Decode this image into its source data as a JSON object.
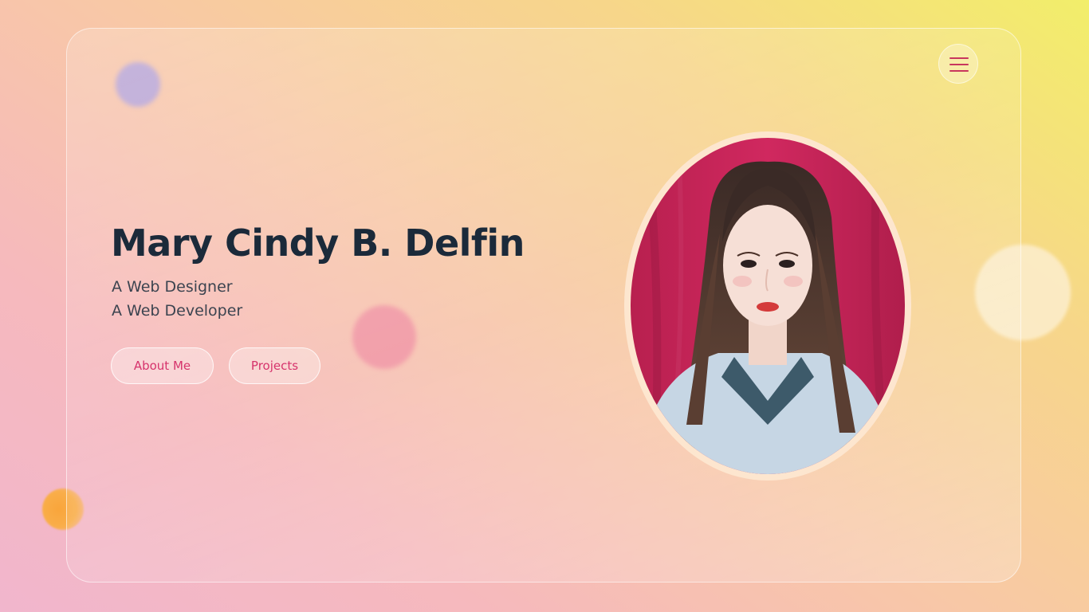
{
  "hero": {
    "name": "Mary Cindy B. Delfin",
    "roles": [
      "A Web Designer",
      "A Web Developer"
    ]
  },
  "buttons": {
    "about": "About Me",
    "projects": "Projects"
  },
  "menu": {
    "icon": "hamburger-menu-icon"
  },
  "colors": {
    "accent": "#d6336c",
    "heading": "#1b2a3a",
    "menu_icon": "#c8365d"
  }
}
